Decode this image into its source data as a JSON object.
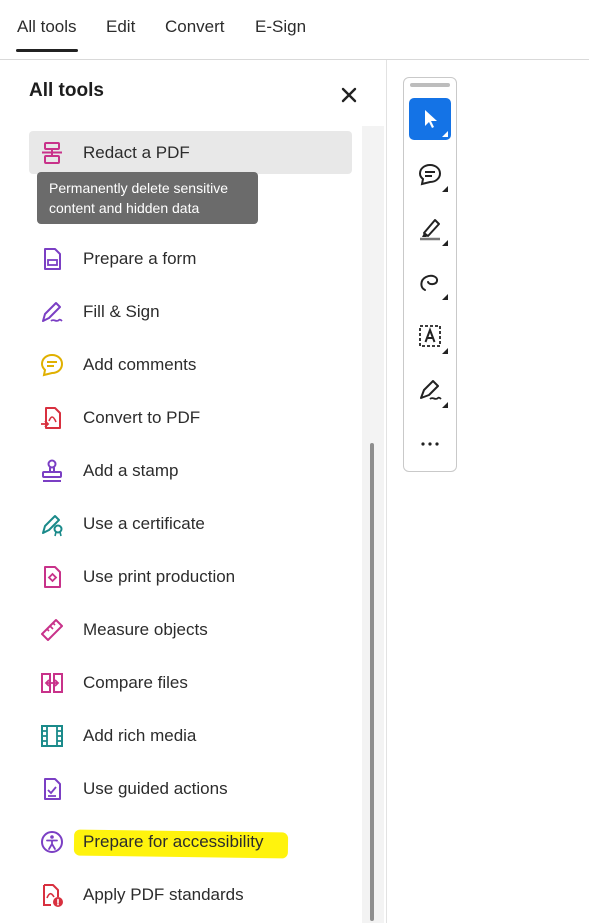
{
  "tabs": [
    {
      "label": "All tools",
      "active": true
    },
    {
      "label": "Edit",
      "active": false
    },
    {
      "label": "Convert",
      "active": false
    },
    {
      "label": "E-Sign",
      "active": false
    }
  ],
  "panel": {
    "title": "All tools"
  },
  "tooltip": "Permanently delete sensitive content and hidden data",
  "tools": [
    {
      "label": "Redact a PDF",
      "icon": "redact-icon",
      "color": "#c8328a"
    },
    {
      "label": "Prepare a form",
      "icon": "form-icon",
      "color": "#7b3fc4"
    },
    {
      "label": "Fill & Sign",
      "icon": "fill-sign-icon",
      "color": "#7b3fc4"
    },
    {
      "label": "Add comments",
      "icon": "comment-icon",
      "color": "#e0b000"
    },
    {
      "label": "Convert to PDF",
      "icon": "convert-pdf-icon",
      "color": "#d8303f"
    },
    {
      "label": "Add a stamp",
      "icon": "stamp-icon",
      "color": "#7b3fc4"
    },
    {
      "label": "Use a certificate",
      "icon": "certificate-icon",
      "color": "#1a8a8a"
    },
    {
      "label": "Use print production",
      "icon": "print-production-icon",
      "color": "#c8328a"
    },
    {
      "label": "Measure objects",
      "icon": "ruler-icon",
      "color": "#c8328a"
    },
    {
      "label": "Compare files",
      "icon": "compare-icon",
      "color": "#c8328a"
    },
    {
      "label": "Add rich media",
      "icon": "film-icon",
      "color": "#1a8a8a"
    },
    {
      "label": "Use guided actions",
      "icon": "guided-actions-icon",
      "color": "#7b3fc4"
    },
    {
      "label": "Prepare for accessibility",
      "icon": "accessibility-icon",
      "color": "#7b3fc4"
    },
    {
      "label": "Apply PDF standards",
      "icon": "pdf-standards-icon",
      "color": "#d8303f"
    }
  ],
  "rail": [
    {
      "name": "select-tool",
      "icon": "cursor-icon",
      "selected": true
    },
    {
      "name": "comment-tool",
      "icon": "comment-bubble-icon",
      "selected": false
    },
    {
      "name": "highlight-tool",
      "icon": "highlighter-icon",
      "selected": false
    },
    {
      "name": "draw-tool",
      "icon": "freehand-draw-icon",
      "selected": false
    },
    {
      "name": "text-select-tool",
      "icon": "text-box-icon",
      "selected": false
    },
    {
      "name": "sign-tool",
      "icon": "sign-pen-icon",
      "selected": false
    },
    {
      "name": "more-tools",
      "icon": "more-icon",
      "selected": false
    }
  ],
  "colors": {
    "accent": "#1473e6",
    "highlight": "#fff200",
    "tooltip_bg": "#6b6b6b"
  }
}
